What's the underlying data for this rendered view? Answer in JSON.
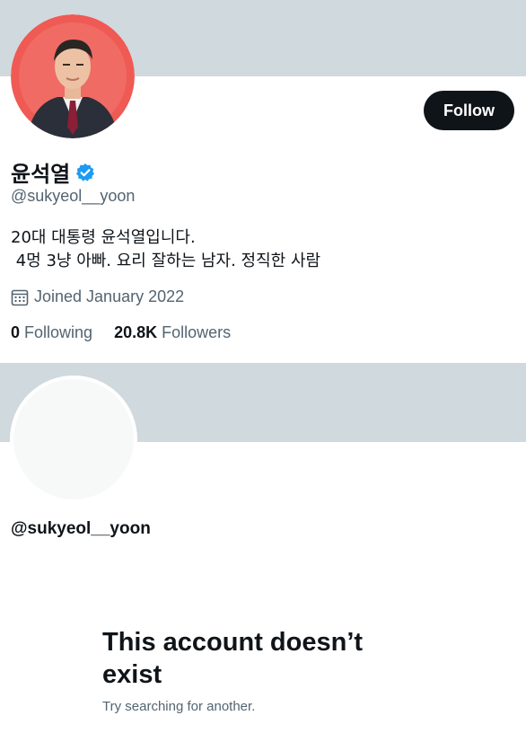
{
  "profile": {
    "display_name": "윤석열",
    "handle": "@sukyeol__yoon",
    "bio": "20대 대통령 윤석열입니다.\n 4멍 3냥 아빠. 요리 잘하는 남자. 정직한 사람",
    "joined": "Joined January 2022",
    "following_count": "0",
    "following_label": "Following",
    "followers_count": "20.8K",
    "followers_label": "Followers",
    "follow_button": "Follow",
    "verified": true
  },
  "missing_profile": {
    "handle": "@sukyeol__yoon",
    "empty_title": "This account doesn’t exist",
    "empty_subtitle": "Try searching for another."
  },
  "colors": {
    "banner": "#cfd9de",
    "verified_blue": "#1d9bf0",
    "avatar_bg": "#f0605a",
    "text_primary": "#0f1419",
    "text_secondary": "#536471"
  }
}
